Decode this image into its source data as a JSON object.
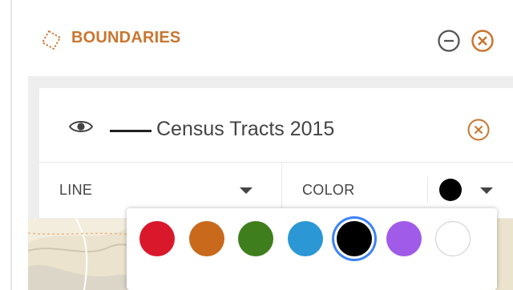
{
  "panel": {
    "title": "BOUNDARIES",
    "icons": {
      "title": "dashed-polygon-icon",
      "minimize": "circle-minus-icon",
      "close": "circle-x-icon"
    }
  },
  "layer": {
    "name": "Census Tracts 2015",
    "line_color": "#222222",
    "icons": {
      "visibility": "eye-icon",
      "remove": "circle-x-icon"
    }
  },
  "controls": {
    "line_label": "LINE",
    "color_label": "COLOR",
    "current_color": "#000000"
  },
  "palette": {
    "colors": [
      "#d9192b",
      "#c8691c",
      "#3f7e1d",
      "#2b97d4",
      "#000000",
      "#a05be8",
      "#ffffff"
    ],
    "selected_index": 4
  },
  "theme": {
    "accent": "#c9762f",
    "selected_ring": "#3b82f6"
  }
}
